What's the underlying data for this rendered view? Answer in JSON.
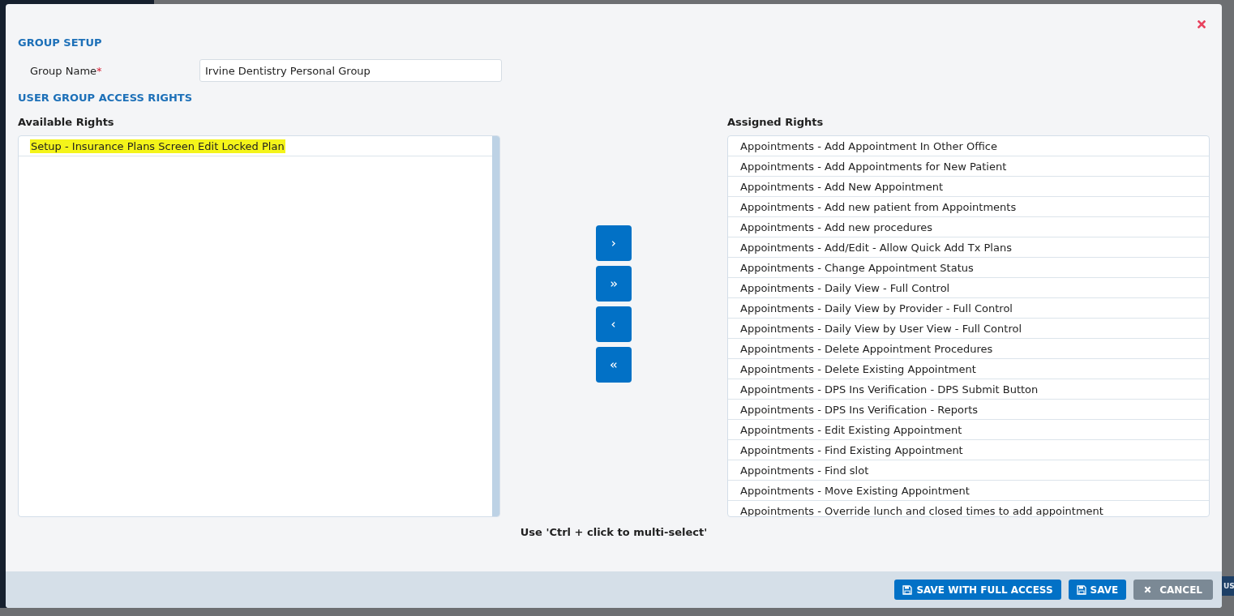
{
  "background": {
    "button_fragment": "US"
  },
  "group_setup": {
    "title": "GROUP SETUP",
    "group_name": {
      "label": "Group Name",
      "required_mark": "*",
      "value": "Irvine Dentistry Personal Group"
    }
  },
  "access_rights": {
    "title": "USER GROUP ACCESS RIGHTS",
    "available": {
      "title": "Available Rights",
      "items": [
        {
          "label": "Setup - Insurance Plans Screen Edit Locked Plan",
          "highlighted": true
        }
      ]
    },
    "transfer_buttons": [
      {
        "kind": "add-one"
      },
      {
        "kind": "add-all"
      },
      {
        "kind": "remove-one"
      },
      {
        "kind": "remove-all"
      }
    ],
    "assigned": {
      "title": "Assigned Rights",
      "items": [
        {
          "label": "Appointments - Add Appointment In Other Office",
          "highlighted": false
        },
        {
          "label": "Appointments - Add Appointments for New Patient",
          "highlighted": false
        },
        {
          "label": "Appointments - Add New Appointment",
          "highlighted": false
        },
        {
          "label": "Appointments - Add new patient from Appointments",
          "highlighted": false
        },
        {
          "label": "Appointments - Add new procedures",
          "highlighted": false
        },
        {
          "label": "Appointments - Add/Edit - Allow Quick Add Tx Plans",
          "highlighted": false
        },
        {
          "label": "Appointments - Change Appointment Status",
          "highlighted": false
        },
        {
          "label": "Appointments - Daily View - Full Control",
          "highlighted": false
        },
        {
          "label": "Appointments - Daily View by Provider - Full Control",
          "highlighted": false
        },
        {
          "label": "Appointments - Daily View by User View - Full Control",
          "highlighted": false
        },
        {
          "label": "Appointments - Delete Appointment Procedures",
          "highlighted": false
        },
        {
          "label": "Appointments - Delete Existing Appointment",
          "highlighted": false
        },
        {
          "label": "Appointments - DPS Ins Verification - DPS Submit Button",
          "highlighted": false
        },
        {
          "label": "Appointments - DPS Ins Verification - Reports",
          "highlighted": false
        },
        {
          "label": "Appointments - Edit Existing Appointment",
          "highlighted": false
        },
        {
          "label": "Appointments - Find Existing Appointment",
          "highlighted": false
        },
        {
          "label": "Appointments - Find slot",
          "highlighted": false
        },
        {
          "label": "Appointments - Move Existing Appointment",
          "highlighted": false
        },
        {
          "label": "Appointments - Override lunch and closed times to add appointment",
          "highlighted": false
        }
      ]
    },
    "hint": "Use 'Ctrl + click to multi-select'"
  },
  "footer": {
    "buttons": [
      {
        "label": "SAVE WITH FULL ACCESS",
        "kind": "save"
      },
      {
        "label": "SAVE",
        "kind": "save"
      },
      {
        "label": "CANCEL",
        "kind": "cancel"
      }
    ]
  }
}
